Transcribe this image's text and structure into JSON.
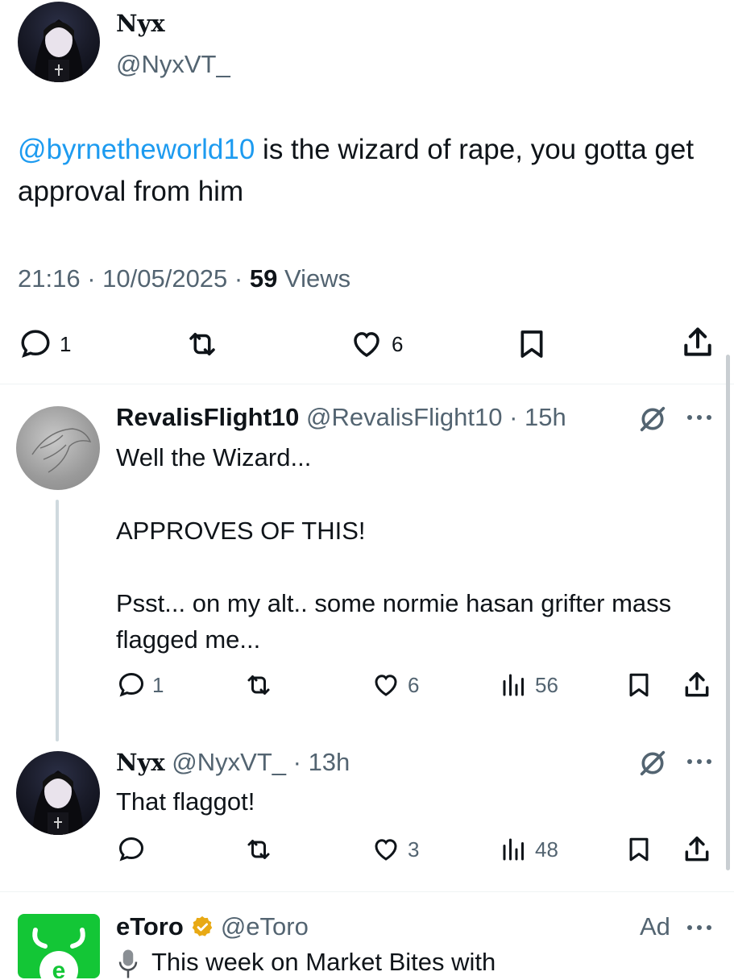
{
  "main_tweet": {
    "display_name": "Nyx",
    "handle": "@NyxVT_",
    "mention": "@byrnetheworld10",
    "text_after_mention": " is the wizard of rape, you gotta get approval from him",
    "time": "21:16",
    "date": "10/05/2025",
    "views_count": "59",
    "views_label": "Views",
    "replies": "1",
    "likes": "6"
  },
  "replies": [
    {
      "display_name": "RevalisFlight10",
      "handle": "@RevalisFlight10",
      "time": "15h",
      "lines": [
        "Well the Wizard...",
        "APPROVES OF THIS!",
        "Psst... on my alt.. some normie hasan grifter mass flagged me..."
      ],
      "replies": "1",
      "likes": "6",
      "views": "56"
    },
    {
      "display_name": "Nyx",
      "handle": "@NyxVT_",
      "time": "13h",
      "text": "That flaggot!",
      "likes": "3",
      "views": "48"
    }
  ],
  "ad": {
    "display_name": "eToro",
    "handle": "@eToro",
    "ad_label": "Ad",
    "text": "This week on Market Bites with"
  },
  "colors": {
    "link": "#1d9bf0",
    "muted": "#536471",
    "text": "#0f1419",
    "brand_etoro": "#13c636",
    "verified_gold": "#e8a914"
  }
}
